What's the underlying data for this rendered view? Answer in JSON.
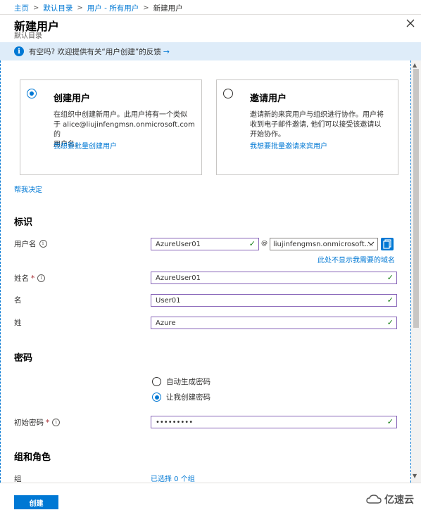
{
  "breadcrumb": {
    "home": "主页",
    "directory": "默认目录",
    "users": "用户 - 所有用户",
    "current": "新建用户",
    "sep": ">"
  },
  "blade": {
    "title": "新建用户",
    "subtitle": "默认目录"
  },
  "banner": {
    "text": "有空吗? 欢迎提供有关“用户创建”的反馈",
    "arrow": "→",
    "icon": "info-icon"
  },
  "cards": {
    "create": {
      "title": "创建用户",
      "desc_line1": "在组织中创建新用户。此用户将有一个类似",
      "desc_line2": "于 alice@liujinfengmsn.onmicrosoft.com 的",
      "desc_line3": "用户名。",
      "link": "我想要批量创建用户",
      "selected": true
    },
    "invite": {
      "title": "邀请用户",
      "desc_line1": "邀请新的来宾用户与组织进行协作。用户将",
      "desc_line2": "收到电子邮件邀请, 他们可以接受该邀请以",
      "desc_line3": "开始协作。",
      "link": "我想要批量邀请来宾用户",
      "selected": false
    }
  },
  "help_link": "帮我决定",
  "identity": {
    "section": "标识",
    "username_label": "用户名",
    "username_value": "AzureUser01",
    "at": "@",
    "domain_value": "liujinfengmsn.onmicrosoft....",
    "domain_missing_link": "此处不显示我需要的域名",
    "name_label": "姓名",
    "name_value": "AzureUser01",
    "first_label": "名",
    "first_value": "User01",
    "last_label": "姓",
    "last_value": "Azure"
  },
  "password": {
    "section": "密码",
    "auto_option": "自动生成密码",
    "manual_option": "让我创建密码",
    "selected": "manual",
    "initial_label": "初始密码",
    "initial_value": "•••••••••"
  },
  "groups": {
    "section": "组和角色",
    "group_label": "组",
    "group_value": "已选择 0 个组"
  },
  "footer": {
    "create_label": "创建"
  },
  "watermark": "亿速云",
  "colors": {
    "accent": "#0078d4",
    "banner_bg": "#deecf9",
    "valid_border": "#8764b8",
    "check": "#107c10",
    "required": "#a4262c"
  }
}
